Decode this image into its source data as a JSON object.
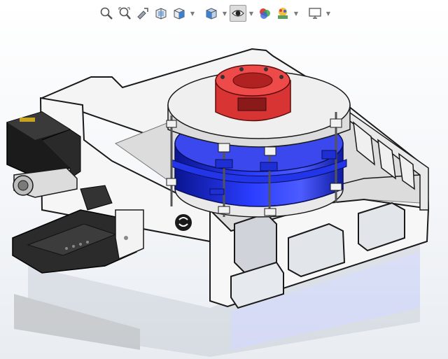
{
  "window": {
    "view": "3d-graphics-area"
  },
  "toolbar": {
    "items": [
      {
        "icon": "zoom-to-fit-icon"
      },
      {
        "icon": "zoom-to-area-icon"
      },
      {
        "icon": "previous-view-icon"
      },
      {
        "icon": "section-view-icon"
      },
      {
        "icon": "view-orientation-icon",
        "dropdown": true
      },
      {
        "icon": "display-style-icon",
        "dropdown": true
      },
      {
        "icon": "hide-show-items-icon",
        "dropdown": true,
        "active": true
      },
      {
        "icon": "edit-appearance-icon"
      },
      {
        "icon": "apply-scene-icon",
        "dropdown": true
      },
      {
        "icon": "view-settings-icon",
        "dropdown": true
      }
    ]
  },
  "colors": {
    "frame": "#f2f2f2",
    "frame_edge": "#1a1a1a",
    "ring_blue": "#1f2fd6",
    "red_part": "#e23a3a",
    "motor": "#1b1b1b",
    "bracket": "#2b2b2b",
    "disk": "#ececec"
  }
}
